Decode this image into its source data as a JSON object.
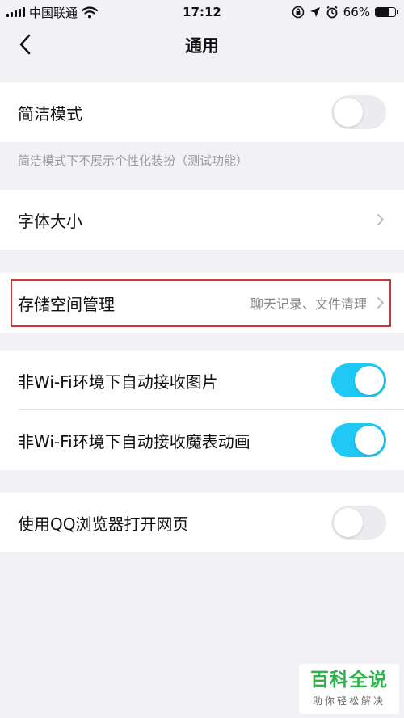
{
  "status_bar": {
    "carrier": "中国联通",
    "time": "17:12",
    "battery": "66%",
    "battery_level": 0.66
  },
  "nav": {
    "title": "通用",
    "back_icon": "chevron-left-icon"
  },
  "settings": {
    "simple_mode": {
      "label": "简洁模式",
      "enabled": false
    },
    "simple_mode_note": "简洁模式下不展示个性化装扮（测试功能）",
    "font_size": {
      "label": "字体大小"
    },
    "storage": {
      "label": "存储空间管理",
      "detail": "聊天记录、文件清理"
    },
    "auto_images": {
      "label": "非Wi-Fi环境下自动接收图片",
      "enabled": true
    },
    "auto_magic_emoji": {
      "label": "非Wi-Fi环境下自动接收魔表动画",
      "enabled": true
    },
    "qq_browser": {
      "label": "使用QQ浏览器打开网页",
      "enabled": false
    }
  },
  "colors": {
    "toggle_on": "#1fc8f5",
    "toggle_off": "#ececf0",
    "highlight_border": "#c93b3b",
    "background": "#f2f2f6"
  },
  "watermark": {
    "title": "百科全说",
    "subtitle": "助你轻松解决"
  }
}
